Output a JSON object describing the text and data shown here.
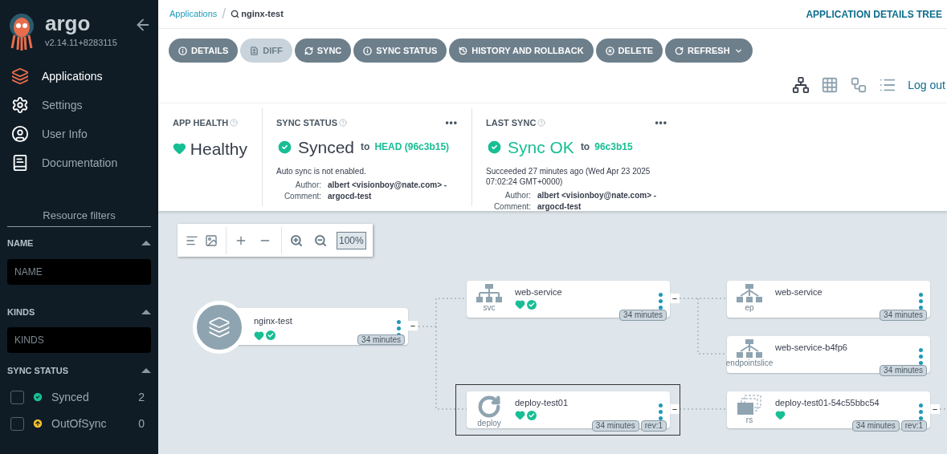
{
  "sidebar": {
    "logo": "argo",
    "version": "v2.14.11+8283115",
    "nav": [
      {
        "label": "Applications",
        "kind": "apps",
        "selected": true
      },
      {
        "label": "Settings",
        "kind": "settings",
        "selected": false
      },
      {
        "label": "User Info",
        "kind": "user",
        "selected": false
      },
      {
        "label": "Documentation",
        "kind": "docs",
        "selected": false
      }
    ],
    "filters_title": "Resource filters",
    "filters": [
      {
        "label": "NAME",
        "placeholder": "NAME"
      },
      {
        "label": "KINDS",
        "placeholder": "KINDS"
      }
    ],
    "sync_status": {
      "label": "SYNC STATUS",
      "options": [
        {
          "label": "Synced",
          "count": "2",
          "checked": false,
          "kind": "synced"
        },
        {
          "label": "OutOfSync",
          "count": "0",
          "checked": false,
          "kind": "outofsync"
        }
      ]
    }
  },
  "breadcrumb": {
    "parent": "Applications",
    "separator": "/",
    "current": "nginx-test"
  },
  "page_title": "APPLICATION DETAILS TREE",
  "actions": [
    {
      "label": "DETAILS",
      "kind": "info",
      "disabled": false
    },
    {
      "label": "DIFF",
      "kind": "diff",
      "disabled": true
    },
    {
      "label": "SYNC",
      "kind": "sync",
      "disabled": false
    },
    {
      "label": "SYNC STATUS",
      "kind": "info",
      "disabled": false
    },
    {
      "label": "HISTORY AND ROLLBACK",
      "kind": "history",
      "disabled": false
    },
    {
      "label": "DELETE",
      "kind": "delete",
      "disabled": false
    },
    {
      "label": "REFRESH",
      "kind": "refresh",
      "disabled": false
    }
  ],
  "views": [
    {
      "kind": "tree",
      "selected": true
    },
    {
      "kind": "grid",
      "selected": false
    },
    {
      "kind": "network",
      "selected": false
    },
    {
      "kind": "list",
      "selected": false
    }
  ],
  "logout": "Log out",
  "app_health": {
    "label": "APP HEALTH",
    "value": "Healthy"
  },
  "sync_status": {
    "label": "SYNC STATUS",
    "more": "•••",
    "value": "Synced",
    "to": "to",
    "revision": "HEAD (96c3b15)",
    "note": "Auto sync is not enabled.",
    "author_label": "Author:",
    "author": "albert <visionboy@nate.com> -",
    "comment_label": "Comment:",
    "comment": "argocd-test"
  },
  "last_sync": {
    "label": "LAST SYNC",
    "more": "•••",
    "value": "Sync OK",
    "to": "to",
    "revision": "96c3b15",
    "note": "Succeeded 27 minutes ago (Wed Apr 23 2025 07:02:24 GMT+0000)",
    "author_label": "Author:",
    "author": "albert <visionboy@nate.com> -",
    "comment_label": "Comment:",
    "comment": "argocd-test"
  },
  "graph_toolbar": {
    "zoom": "100%"
  },
  "app_node": {
    "name": "nginx-test",
    "age": "34 minutes",
    "healthy": true,
    "synced": true,
    "collapse": "−"
  },
  "nodes": [
    {
      "name": "web-service",
      "kind": "svc",
      "age": "34 minutes",
      "healthy": true,
      "synced": true,
      "selected": false,
      "collapse": "−"
    },
    {
      "name": "deploy-test01",
      "kind": "deploy",
      "age": "34 minutes",
      "rev": "rev:1",
      "healthy": true,
      "synced": true,
      "selected": true,
      "collapse": "−"
    },
    {
      "name": "web-service",
      "kind": "ep",
      "age": "34 minutes",
      "healthy": false,
      "synced": false,
      "selected": false
    },
    {
      "name": "web-service-b4fp6",
      "kind": "endpointslice",
      "age": "34 minutes",
      "healthy": false,
      "synced": false,
      "selected": false
    },
    {
      "name": "deploy-test01-54c55bbc54",
      "kind": "rs",
      "age": "34 minutes",
      "rev": "rev:1",
      "healthy": true,
      "synced": false,
      "selected": false,
      "collapse": "−"
    }
  ]
}
